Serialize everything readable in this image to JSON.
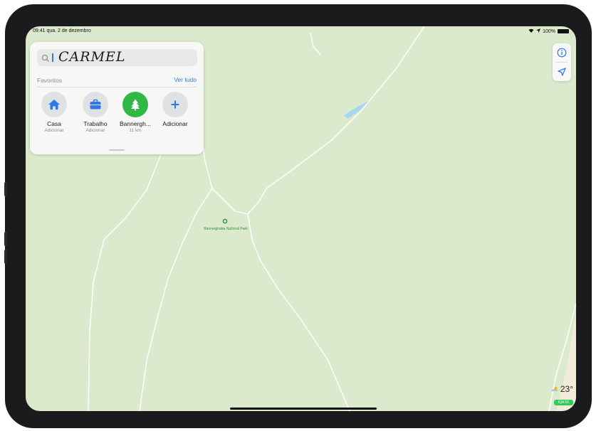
{
  "status_bar": {
    "time": "09:41",
    "date": "qua. 2 de dezembro",
    "battery": "100%"
  },
  "search": {
    "value": "CARMEL"
  },
  "favorites": {
    "label": "Favoritos",
    "see_all": "Ver tudo",
    "items": [
      {
        "name": "Casa",
        "sub": "Adicionar",
        "icon": "house-icon",
        "color": "#2f78e6"
      },
      {
        "name": "Trabalho",
        "sub": "Adicionar",
        "icon": "briefcase-icon",
        "color": "#2f78e6"
      },
      {
        "name": "Bannergh...",
        "sub": "11 km",
        "icon": "tree-icon",
        "color": "#2fb844"
      },
      {
        "name": "Adicionar",
        "sub": "",
        "icon": "plus-icon",
        "color": "#2f78e6"
      }
    ]
  },
  "map": {
    "poi": {
      "name": "Bannerghatta National Park",
      "icon": "park-pin-icon"
    }
  },
  "controls": {
    "info_icon": "info-icon",
    "location_icon": "location-arrow-icon"
  },
  "weather": {
    "temperature": "23°",
    "aqi": "IQA 55",
    "icon": "cloud-sun-icon"
  },
  "colors": {
    "accent": "#2f78e6",
    "map_land": "#dbeacd",
    "park_green": "#34c759"
  }
}
